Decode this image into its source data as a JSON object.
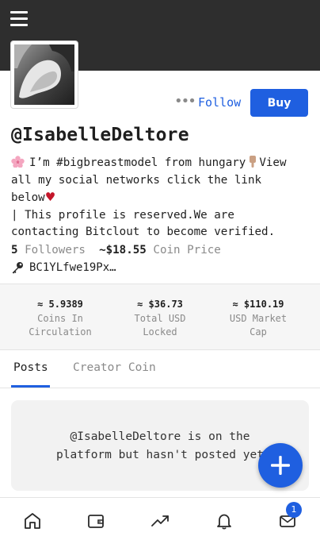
{
  "profile": {
    "username": "@IsabelleDeltore",
    "follow_label": "Follow",
    "buy_label": "Buy",
    "more_label": "•••",
    "bio_line1_text": "I’m #bigbreastmodel from hungary",
    "bio_line1_tail": "View",
    "bio_line2": "all my social networks click the link",
    "bio_line3": "below",
    "bio_line4": "| This profile is reserved.We are",
    "bio_line5": "contacting Bitclout to become verified.",
    "followers_count": "5",
    "followers_label": "Followers",
    "coin_price": "~$18.55",
    "coin_price_label": "Coin Price",
    "public_key": "BC1YLfwe19Px…"
  },
  "coin_stats": [
    {
      "value": "≈ 5.9389",
      "label": "Coins In\nCirculation"
    },
    {
      "value": "≈ $36.73",
      "label": "Total USD\nLocked"
    },
    {
      "value": "≈ $110.19",
      "label": "USD Market\nCap"
    }
  ],
  "tabs": [
    {
      "label": "Posts",
      "active": true
    },
    {
      "label": "Creator Coin",
      "active": false
    }
  ],
  "empty_state": {
    "line1": "@IsabelleDeltore is on the",
    "line2": "platform but hasn't posted yet"
  },
  "bottom_nav": {
    "items": [
      "home-icon",
      "wallet-icon",
      "trending-icon",
      "bell-icon",
      "mail-icon"
    ],
    "mail_badge": "1"
  },
  "colors": {
    "header_bg": "#2e2e2e",
    "accent": "#1f5fe0",
    "muted_text": "#8a8a8a",
    "panel_bg": "#f6f6f6"
  }
}
